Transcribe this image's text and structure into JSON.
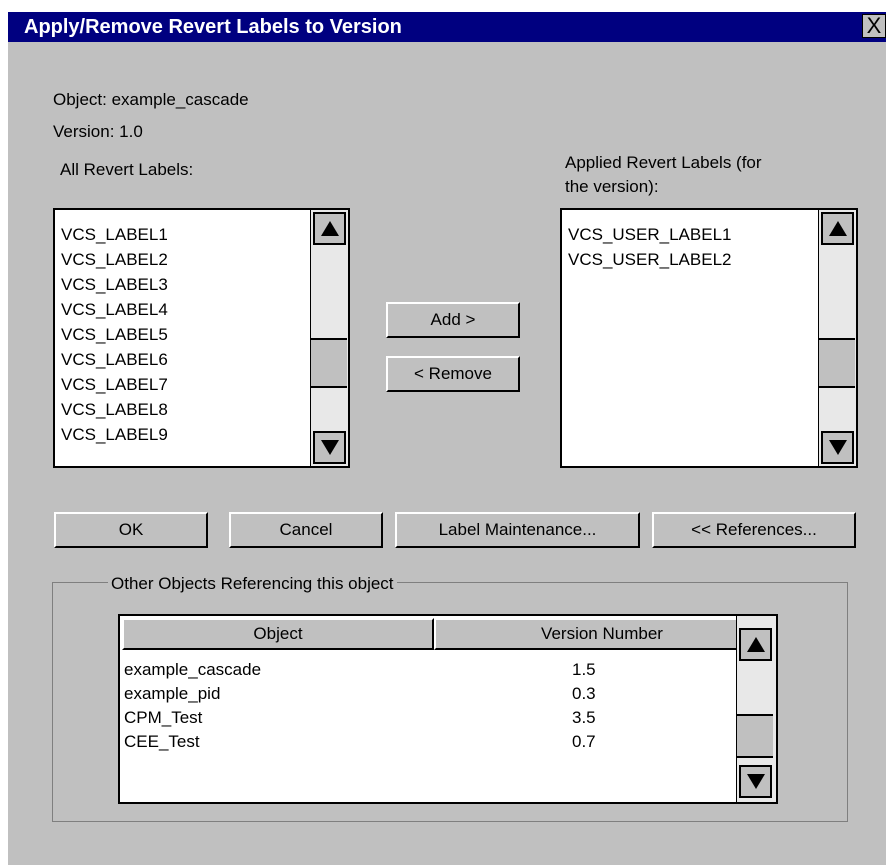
{
  "dialog": {
    "title": "Apply/Remove Revert Labels to Version",
    "close_glyph": "X"
  },
  "object_label": "Object: example_cascade",
  "version_label": "Version: 1.0",
  "all_labels": {
    "heading": "All Revert  Labels:",
    "items": [
      "VCS_LABEL1",
      "VCS_LABEL2",
      "VCS_LABEL3",
      "VCS_LABEL4",
      "VCS_LABEL5",
      "VCS_LABEL6",
      "VCS_LABEL7",
      "VCS_LABEL8",
      "VCS_LABEL9"
    ]
  },
  "applied_labels": {
    "heading_line1": "Applied Revert Labels (for",
    "heading_line2": "the version):",
    "items": [
      "VCS_USER_LABEL1",
      "VCS_USER_LABEL2"
    ]
  },
  "buttons": {
    "add": "Add >",
    "remove": "< Remove",
    "ok": "OK",
    "cancel": "Cancel",
    "label_maintenance": "Label Maintenance...",
    "references": "<< References..."
  },
  "references": {
    "group_title": "Other Objects Referencing this object",
    "columns": [
      "Object",
      "Version Number"
    ],
    "rows": [
      {
        "object": "example_cascade",
        "version": "1.5"
      },
      {
        "object": "example_pid",
        "version": "0.3"
      },
      {
        "object": "CPM_Test",
        "version": "3.5"
      },
      {
        "object": "CEE_Test",
        "version": "0.7"
      }
    ]
  },
  "icons": {
    "scroll_up": "triangle-up",
    "scroll_down": "triangle-down",
    "close": "x-mark"
  },
  "colors": {
    "titlebar": "#000080",
    "dialog_bg": "#c0c0c0",
    "list_bg": "#ffffff"
  }
}
